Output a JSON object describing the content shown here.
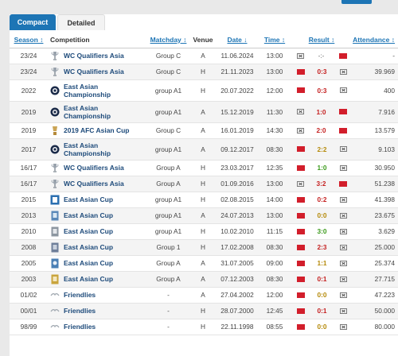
{
  "tabs": {
    "compact": "Compact",
    "detailed": "Detailed"
  },
  "headers": {
    "season": "Season ↕",
    "competition": "Competition",
    "matchday": "Matchday ↕",
    "venue": "Venue",
    "date": "Date ↓",
    "time": "Time ↕",
    "result": "Result ↕",
    "attendance": "Attendance ↕"
  },
  "rows": [
    {
      "season": "23/24",
      "comp": "WC Qualifiers Asia",
      "icon": "trophy-icon",
      "matchday": "Group C",
      "venue": "A",
      "date": "11.06.2024",
      "time": "13:00",
      "home": "badge",
      "score": "-:-",
      "away": "flag",
      "outcome": "none",
      "attendance": "-"
    },
    {
      "season": "23/24",
      "comp": "WC Qualifiers Asia",
      "icon": "trophy-icon",
      "matchday": "Group C",
      "venue": "H",
      "date": "21.11.2023",
      "time": "13:00",
      "home": "flag",
      "score": "0:3",
      "away": "badge",
      "outcome": "loss",
      "attendance": "39.969"
    },
    {
      "season": "2022",
      "comp": "East Asian Championship",
      "icon": "eaff-icon",
      "matchday": "group A1",
      "venue": "H",
      "date": "20.07.2022",
      "time": "12:00",
      "home": "flag",
      "score": "0:3",
      "away": "badge",
      "outcome": "loss",
      "attendance": "400"
    },
    {
      "season": "2019",
      "comp": "East Asian Championship",
      "icon": "eaff-icon",
      "matchday": "group A1",
      "venue": "A",
      "date": "15.12.2019",
      "time": "11:30",
      "home": "badge",
      "score": "1:0",
      "away": "flag",
      "outcome": "loss",
      "attendance": "7.916"
    },
    {
      "season": "2019",
      "comp": "2019 AFC Asian Cup",
      "icon": "afc-icon",
      "matchday": "Group C",
      "venue": "A",
      "date": "16.01.2019",
      "time": "14:30",
      "home": "badge",
      "score": "2:0",
      "away": "flag",
      "outcome": "loss",
      "attendance": "13.579"
    },
    {
      "season": "2017",
      "comp": "East Asian Championship",
      "icon": "eaff-icon",
      "matchday": "group A1",
      "venue": "A",
      "date": "09.12.2017",
      "time": "08:30",
      "home": "flag",
      "score": "2:2",
      "away": "badge",
      "outcome": "draw",
      "attendance": "9.103"
    },
    {
      "season": "16/17",
      "comp": "WC Qualifiers Asia",
      "icon": "trophy-icon",
      "matchday": "Group A",
      "venue": "H",
      "date": "23.03.2017",
      "time": "12:35",
      "home": "flag",
      "score": "1:0",
      "away": "badge",
      "outcome": "win",
      "attendance": "30.950"
    },
    {
      "season": "16/17",
      "comp": "WC Qualifiers Asia",
      "icon": "trophy-icon",
      "matchday": "Group A",
      "venue": "H",
      "date": "01.09.2016",
      "time": "13:00",
      "home": "badge",
      "score": "3:2",
      "away": "flag",
      "outcome": "loss",
      "attendance": "51.238"
    },
    {
      "season": "2015",
      "comp": "East Asian Cup",
      "icon": "eac-2015-icon",
      "matchday": "group A1",
      "venue": "H",
      "date": "02.08.2015",
      "time": "14:00",
      "home": "flag",
      "score": "0:2",
      "away": "badge",
      "outcome": "loss",
      "attendance": "41.398"
    },
    {
      "season": "2013",
      "comp": "East Asian Cup",
      "icon": "eac-2013-icon",
      "matchday": "group A1",
      "venue": "A",
      "date": "24.07.2013",
      "time": "13:00",
      "home": "flag",
      "score": "0:0",
      "away": "badge",
      "outcome": "draw",
      "attendance": "23.675"
    },
    {
      "season": "2010",
      "comp": "East Asian Cup",
      "icon": "eac-2010-icon",
      "matchday": "group A1",
      "venue": "H",
      "date": "10.02.2010",
      "time": "11:15",
      "home": "flag",
      "score": "3:0",
      "away": "badge",
      "outcome": "win",
      "attendance": "3.629"
    },
    {
      "season": "2008",
      "comp": "East Asian Cup",
      "icon": "eac-2008-icon",
      "matchday": "Group 1",
      "venue": "H",
      "date": "17.02.2008",
      "time": "08:30",
      "home": "flag",
      "score": "2:3",
      "away": "badge",
      "outcome": "loss",
      "attendance": "25.000"
    },
    {
      "season": "2005",
      "comp": "East Asian Cup",
      "icon": "eac-2005-icon",
      "matchday": "Group A",
      "venue": "A",
      "date": "31.07.2005",
      "time": "09:00",
      "home": "flag",
      "score": "1:1",
      "away": "badge",
      "outcome": "draw",
      "attendance": "25.374"
    },
    {
      "season": "2003",
      "comp": "East Asian Cup",
      "icon": "eac-2003-icon",
      "matchday": "Group A",
      "venue": "A",
      "date": "07.12.2003",
      "time": "08:30",
      "home": "flag",
      "score": "0:1",
      "away": "badge",
      "outcome": "loss",
      "attendance": "27.715"
    },
    {
      "season": "01/02",
      "comp": "Friendlies",
      "icon": "friendlies-icon",
      "matchday": "-",
      "venue": "A",
      "date": "27.04.2002",
      "time": "12:00",
      "home": "flag",
      "score": "0:0",
      "away": "badge",
      "outcome": "draw",
      "attendance": "47.223"
    },
    {
      "season": "00/01",
      "comp": "Friendlies",
      "icon": "friendlies-icon",
      "matchday": "-",
      "venue": "H",
      "date": "28.07.2000",
      "time": "12:45",
      "home": "flag",
      "score": "0:1",
      "away": "badge",
      "outcome": "loss",
      "attendance": "50.000"
    },
    {
      "season": "98/99",
      "comp": "Friendlies",
      "icon": "friendlies-icon",
      "matchday": "-",
      "venue": "H",
      "date": "22.11.1998",
      "time": "08:55",
      "home": "flag",
      "score": "0:0",
      "away": "badge",
      "outcome": "draw",
      "attendance": "80.000"
    }
  ],
  "colors": {
    "accent": "#1d75b5",
    "loss": "#c52121",
    "win": "#3b9a1b",
    "draw": "#b58a0a",
    "flag": "#d21e2b"
  }
}
